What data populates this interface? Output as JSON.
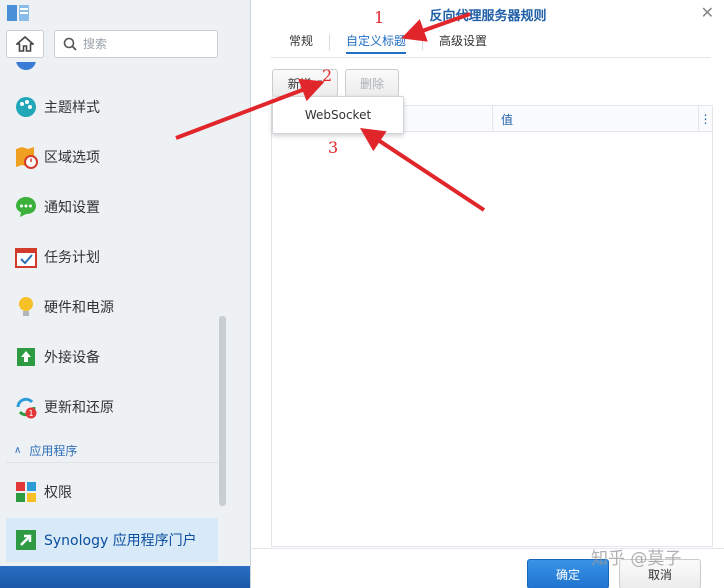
{
  "sidebar": {
    "search_placeholder": "搜索",
    "items": [
      {
        "label": "主题样式",
        "icon": "palette-icon"
      },
      {
        "label": "区域选项",
        "icon": "map-clock-icon"
      },
      {
        "label": "通知设置",
        "icon": "chat-bubble-icon"
      },
      {
        "label": "任务计划",
        "icon": "calendar-check-icon"
      },
      {
        "label": "硬件和电源",
        "icon": "lightbulb-icon"
      },
      {
        "label": "外接设备",
        "icon": "external-device-icon"
      },
      {
        "label": "更新和还原",
        "icon": "update-icon",
        "badge": "1"
      }
    ],
    "section": "应用程序",
    "apps": [
      {
        "label": "权限",
        "icon": "privileges-icon"
      },
      {
        "label": "Synology 应用程序门户",
        "icon": "app-portal-icon"
      }
    ]
  },
  "dialog": {
    "title": "反向代理服务器规则",
    "tabs": [
      "常规",
      "自定义标题",
      "高级设置"
    ],
    "active_tab": "自定义标题",
    "toolbar": {
      "add_label": "新增",
      "delete_label": "删除"
    },
    "dropdown_item": "WebSocket",
    "table": {
      "columns": [
        "",
        "值"
      ]
    },
    "footer": {
      "ok_label": "确定",
      "cancel_label": "取消"
    }
  },
  "annotations": [
    "1",
    "2",
    "3"
  ],
  "watermark": "知乎 @莫子",
  "colors": {
    "accent": "#1f6fc4",
    "annotation": "#e0262a",
    "active_bg": "#d8e9f8"
  }
}
